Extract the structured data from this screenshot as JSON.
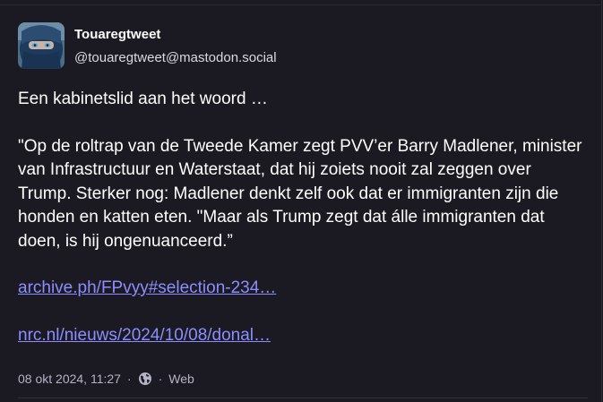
{
  "post": {
    "author": {
      "display_name": "Touaregtweet",
      "handle": "@touaregtweet@mastodon.social"
    },
    "paragraphs": [
      "Een kabinetslid aan het woord …",
      "\"Op de roltrap van de Tweede Kamer zegt PVV’er Barry Madlener, minister van Infrastructuur en Waterstaat, dat hij zoiets nooit zal zeggen over Trump. Sterker nog: Madlener denkt zelf ook dat er immigranten zijn die honden en katten eten. \"Maar als Trump zegt dat álle immigranten dat doen, is hij ongenuanceerd.”"
    ],
    "links": [
      "archive.ph/FPvyy#selection-234…",
      "nrc.nl/nieuws/2024/10/08/donal…"
    ],
    "meta": {
      "timestamp": "08 okt 2024, 11:27",
      "separator": "·",
      "visibility_icon": "globe-icon",
      "application": "Web"
    }
  },
  "colors": {
    "background": "#1b1a22",
    "link": "#8c8dff",
    "text": "#ffffff",
    "muted": "#b3b3c4"
  }
}
